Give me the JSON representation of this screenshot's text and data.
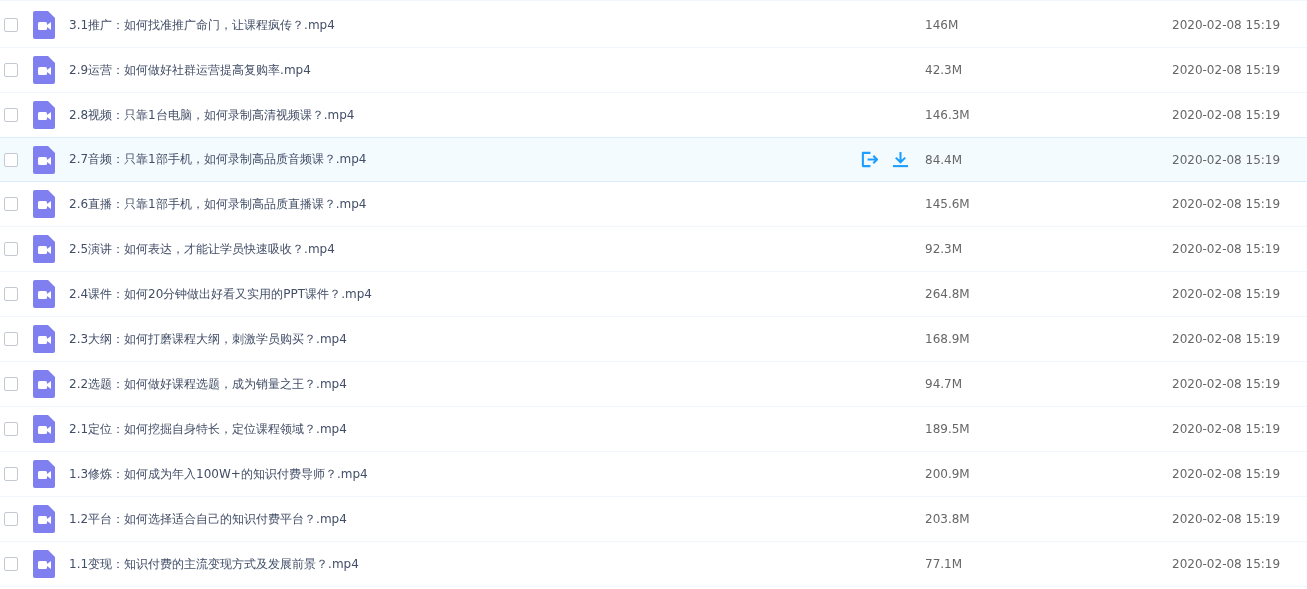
{
  "files": [
    {
      "name": "3.1推广：如何找准推广命门，让课程疯传？.mp4",
      "size": "146M",
      "modified": "2020-02-08 15:19",
      "checked": false,
      "hovered": false
    },
    {
      "name": "2.9运营：如何做好社群运营提高复购率.mp4",
      "size": "42.3M",
      "modified": "2020-02-08 15:19",
      "checked": false,
      "hovered": false
    },
    {
      "name": "2.8视频：只靠1台电脑，如何录制高清视频课？.mp4",
      "size": "146.3M",
      "modified": "2020-02-08 15:19",
      "checked": false,
      "hovered": false
    },
    {
      "name": "2.7音频：只靠1部手机，如何录制高品质音频课？.mp4",
      "size": "84.4M",
      "modified": "2020-02-08 15:19",
      "checked": false,
      "hovered": true
    },
    {
      "name": "2.6直播：只靠1部手机，如何录制高品质直播课？.mp4",
      "size": "145.6M",
      "modified": "2020-02-08 15:19",
      "checked": false,
      "hovered": false
    },
    {
      "name": "2.5演讲：如何表达，才能让学员快速吸收？.mp4",
      "size": "92.3M",
      "modified": "2020-02-08 15:19",
      "checked": false,
      "hovered": false
    },
    {
      "name": "2.4课件：如何20分钟做出好看又实用的PPT课件？.mp4",
      "size": "264.8M",
      "modified": "2020-02-08 15:19",
      "checked": false,
      "hovered": false
    },
    {
      "name": "2.3大纲：如何打磨课程大纲，刺激学员购买？.mp4",
      "size": "168.9M",
      "modified": "2020-02-08 15:19",
      "checked": false,
      "hovered": false
    },
    {
      "name": "2.2选题：如何做好课程选题，成为销量之王？.mp4",
      "size": "94.7M",
      "modified": "2020-02-08 15:19",
      "checked": false,
      "hovered": false
    },
    {
      "name": "2.1定位：如何挖掘自身特长，定位课程领域？.mp4",
      "size": "189.5M",
      "modified": "2020-02-08 15:19",
      "checked": false,
      "hovered": false
    },
    {
      "name": "1.3修炼：如何成为年入100W+的知识付费导师？.mp4",
      "size": "200.9M",
      "modified": "2020-02-08 15:19",
      "checked": false,
      "hovered": false
    },
    {
      "name": "1.2平台：如何选择适合自己的知识付费平台？.mp4",
      "size": "203.8M",
      "modified": "2020-02-08 15:19",
      "checked": false,
      "hovered": false
    },
    {
      "name": "1.1变现：知识付费的主流变现方式及发展前景？.mp4",
      "size": "77.1M",
      "modified": "2020-02-08 15:19",
      "checked": false,
      "hovered": false
    }
  ]
}
